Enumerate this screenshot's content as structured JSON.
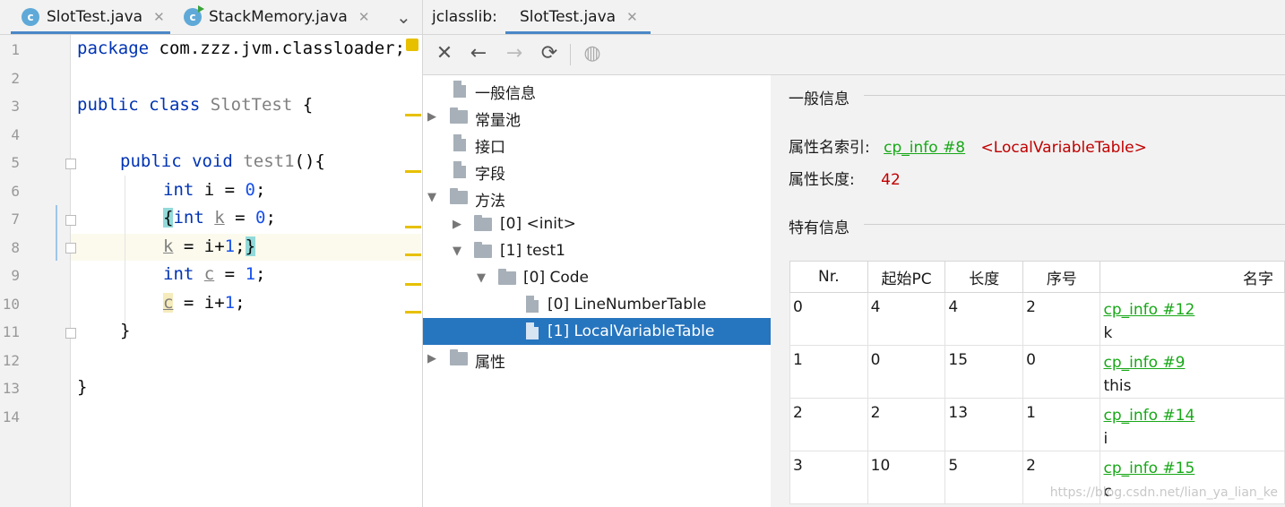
{
  "editor": {
    "tabs": [
      {
        "label": "SlotTest.java",
        "icon": "java-class-icon",
        "active": true
      },
      {
        "label": "StackMemory.java",
        "icon": "java-class-run-icon",
        "active": false
      }
    ],
    "close_glyph": "✕",
    "more_glyph": "⌄",
    "line_numbers": [
      "1",
      "2",
      "3",
      "4",
      "5",
      "6",
      "7",
      "8",
      "9",
      "10",
      "11",
      "12",
      "13",
      "14"
    ],
    "code": {
      "l1": {
        "kw": "package",
        "rest": " com.zzz.jvm.classloader;"
      },
      "l3": {
        "kw1": "public",
        "kw2": "class",
        "name": "SlotTest",
        "rest": " {"
      },
      "l5": {
        "kw1": "public",
        "kw2": "void",
        "name": "test1",
        "rest": "(){"
      },
      "l6": {
        "kw": "int",
        "mid": " i = ",
        "num": "0",
        "end": ";"
      },
      "l7": {
        "brace": "{",
        "kw": "int",
        "var": "k",
        "mid": " = ",
        "num": "0",
        "end": ";"
      },
      "l8": {
        "var": "k",
        "mid": " = i+",
        "num": "1",
        "end": ";",
        "brace": "}"
      },
      "l9": {
        "kw": "int",
        "var": "c",
        "mid": " = ",
        "num": "1",
        "end": ";"
      },
      "l10": {
        "var": "c",
        "mid": " = i+",
        "num": "1",
        "end": ";"
      },
      "l11": "}",
      "l13": "}"
    }
  },
  "jclasslib": {
    "prefix": "jclasslib:",
    "tab_label": "SlotTest.java",
    "toolbar": {
      "close": "✕",
      "back": "←",
      "forward": "→",
      "refresh": "⟳",
      "web": "◍"
    }
  },
  "tree": {
    "general": "一般信息",
    "constant_pool": "常量池",
    "interfaces": "接口",
    "fields": "字段",
    "methods": "方法",
    "m0": "[0] <init>",
    "m1": "[1] test1",
    "code": "[0] Code",
    "lnt": "[0] LineNumberTable",
    "lvt": "[1] LocalVariableTable",
    "attributes": "属性"
  },
  "details": {
    "general_title": "一般信息",
    "attr_name_label": "属性名索引:",
    "attr_name_link": "cp_info #8",
    "attr_name_value": "<LocalVariableTable>",
    "attr_len_label": "属性长度:",
    "attr_len_value": "42",
    "specific_title": "特有信息",
    "columns": [
      "Nr.",
      "起始PC",
      "长度",
      "序号",
      "名字"
    ],
    "rows": [
      {
        "nr": "0",
        "start_pc": "4",
        "length": "4",
        "index": "2",
        "link": "cp_info #12",
        "name": "k"
      },
      {
        "nr": "1",
        "start_pc": "0",
        "length": "15",
        "index": "0",
        "link": "cp_info #9",
        "name": "this"
      },
      {
        "nr": "2",
        "start_pc": "2",
        "length": "13",
        "index": "1",
        "link": "cp_info #14",
        "name": "i"
      },
      {
        "nr": "3",
        "start_pc": "10",
        "length": "5",
        "index": "2",
        "link": "cp_info #15",
        "name": "c"
      }
    ]
  },
  "watermark": "https://blog.csdn.net/lian_ya_lian_ke",
  "colors": {
    "selection": "#2675bf",
    "link": "#18a818",
    "value_red": "#c00000",
    "keyword": "#0033b3",
    "warning": "#e7c000"
  }
}
